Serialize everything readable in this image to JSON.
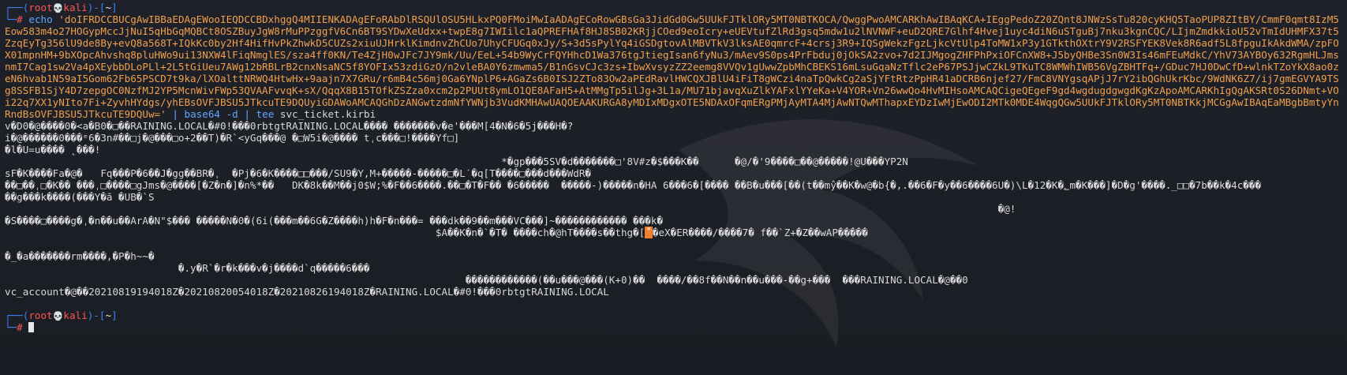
{
  "prompt1": {
    "corner_top": "┌──(",
    "user": "root",
    "skull": "💀",
    "host": "kali",
    "after_host": ")-[",
    "path": "~",
    "close": "]",
    "corner_bottom": "└─",
    "symbol": "#"
  },
  "command": {
    "echo": "echo",
    "string": "'doIFRDCCBUCgAwIBBaEDAgEWooIEQDCCBDxhggQ4MIIENKADAgEFoRAbDlRSQUlOSU5HLkxPQ0FMoiMwIaADAgECoRowGBsGa3JidGd0Gw5UUkFJTklORy5MT0NBTKOCA/QwggPwoAMCARKhAwIBAqKCA+IEggPedoZ20ZQnt8JNWzSsTu820cyKHQ5TaoPUP8ZItBY/CmmF0qmt8IzM5Eow583m4o27HOGypMccJjNuI5qHbGqMQBCt8OSZBuyJgW8rMuPPzggfV6Cn6BT9SYDwXeUdxx+twpE8g7IWIilc1aQPREFHAf8HJ8SB02KRjjCOed9eoIcry+eUEVtufZlRd3gsq5mdw1u2lNVNWF+euD2QRE7Glhf4Hvej1uyc4diN6uSTguBj7nku3kgnCQC/LIjmZmdkkioU52vTmIdUHMFX37t5ZzqEyTg356lU9de8By+evQ8a568T+IQkKc0by2Hf4HifHvPkZhwkD5CUZs2xiuUJHrklKimdnvZhCUo7UhyCFUGq0xJy/S+3d5sPylYq4iGSDgtovAlMBVTkV3lksAE0qmrcF+4crsj3R9+IQSgWekzFgzLjkcVtUlp4ToMW1xP3y1GTkthOXtrY9V2RSFYEK8Vek8R6adf5L8fpguIkAkdWMA/zpFOX01mpnHM+9bXOpcAhvshq8pluHWo9ui13NXW4lFiqNmglES/sza4ff0KN/Te4ZjH0wJFc7JY9mk/Uu/EeL+54b9WyCrFQYHhcD1Wa376tgJtiegIsan6fyNu3/mAev9S0ps4PrFbduj0jOkSA2zvo+7d2IJMgogZHFPhPxiOFCnXW8+J5byQHBe3Sn0W3Is46mFEuMdkC/YhV73AYBOy632RgmHLJmsnmI7Cag1sw2Va4pXEybbDLoPLl+2L5tGiUeu7AWg12bRBLrB2cnxNsaNC5f8YOFIx53zdiGzO/n2vleBA0Y6zmwma5/B1nGsvCJc3zs+IbwXvsyzZZ2eemg8VVQv1gUwwZpbMhCBEKS16mLsuGqaNzTflc2eP67PSJjwCZkL9TKuTC8WMWhIWB56VgZBHTFq+/GDuc7HJ0DwCfD+wlnkTZoYkX8ao0zeN6hvab1N59aI5Gom62Fb65PSCD7t9ka/lXOalttNRWQ4HtwHx+9aajn7X7GRu/r6mB4c56mj0Ga6YNplP6+AGaZs6B0ISJ2ZTo83Ow2aPEdRavlHWCQXJBlU4iFiT8gWCzi4naTpQwkCg2aSjYFtRtzPpHR41aDCRB6njef27/FmC8VNYgsqAPjJ7rY2ibQGhUkrKbc/9WdNK6Z7/ij7gmEGVYA9TSg8SSFB1SjY4D7zepgOC0NzfMJ2YP5McnWivFWp53QVAAFvvqK+sX/QqqX8B15TOfkZSZza0xcm2p2PUUt8ymLO1QE8AFaH5+AtMMgTp5ilJg+3L1a/MU71bjavqXuZlkYAFxlYYeKa+V4YOR+Vn26wwQo4HvMIHsoAMCAQCigeQEgeF9gd4wgdugdgwgdKgKzApoAMCARKhIgQgAKSRt0S26DNmt+VOi22q7XX1yNIto7Fi+ZyvhHYdgs/yhEBsOVFJBSU5JTkcuTE9DQUyiGDAWoAMCAQGhDzANGwtzdmNfYWNjb3VudKMHAwUAQOEAAKURGA8yMDIxMDgxOTE5NDAxOFqmERgPMjAyMTA4MjAwNTQwMThapxEYDzIwMjEwODI2MTk0MDE4WqgQGw5UUkFJTklORy5MT0NBTKkjMCGgAwIBAqEaMBgbBmtyYnRndBsOVFJBSU5JTkcuTE9DQUw='",
    "pipe1": "|",
    "base64": "base64 -d",
    "pipe2": "|",
    "tee": "tee",
    "tee_arg": "svc_ticket.kirbi"
  },
  "output": {
    "lines": [
      "v�D0�@����0�<a�B0�□��RAINING.LOCAL�#0!���0rbtgtRAINING.LOCAL���� �������v�e'���M[4�N�6�5j���H�?",
      "i�@������0���ᵉ6�3n#��□j�@���□o+2��T)�R`<yGq���@ �□W5i�@���� tˌc���□!����Yf□]",
      "�l�U=u���� ˛���!",
      "                                                                                   *�gp���5SV�d�������□'8V#z�$���K��      �@/�'9����□��@�����!@U���YP2N",
      "sF�K����Fa�@�   Fq���P�6��J�gg��BR�ˌ  �Pj�6�K����□□���/SU9�Y,M+�����-�����□�Lˊ�q[T����□���d���WdR�",
      "��□��ˌ□�K�� ���ˌ□����□gJms�@����[�Z�n�]�n%*��   DK�8k��M��j0$W;%�F��6����.��□�T�F�� �6�����  �����-)�����n�HA 6���6�[���� ��B�u���[��(t��mŷ��K�w@�b{�,.��6�F�y��6����6U�)\\L�12�K�؂m�K���]�D�g'����._□□�7b��k�4c���",
      "��g���k����(���Y�ã �UB�`S",
      "                                                                                                                                                                      �@!",
      "�S����□����g�ˌ�n��u��ArA�N\"$��� �����N�0�(6i(���m��6G�Z����h)h�F�n���= ���dk��9��m���VC���]~������������ ���k�",
      "                                                                        $A��K�n�`�T� ����ch�@hT����s��thg�[˚�eX�ER����/����7� f��`Z+�Z��wAP�����",
      "�_�a�������rm����,�P�h~~�",
      "                             �.y�R`�r�k���v�j����d`q�����6���",
      "                                                                             ������������(��u���@���(K+0)��  ����/��8f��N��n��u���-��g+���  ���RAINING.LOCAL�@��0",
      "vc_account�@��20210819194018Z�20210820054018Z�20210826194018Z�RAINING.LOCAL�#0!���0rbtgtRAINING.LOCAL"
    ],
    "highlight_line_index": 9,
    "highlight_text": "˚",
    "highlight_color": "#f07f2d"
  },
  "colors": {
    "background": "#1c1e26",
    "prompt_blue": "#3b82f6",
    "prompt_red": "#ff5555",
    "string_orange": "#f0a04b",
    "text": "#d8d8d8"
  }
}
